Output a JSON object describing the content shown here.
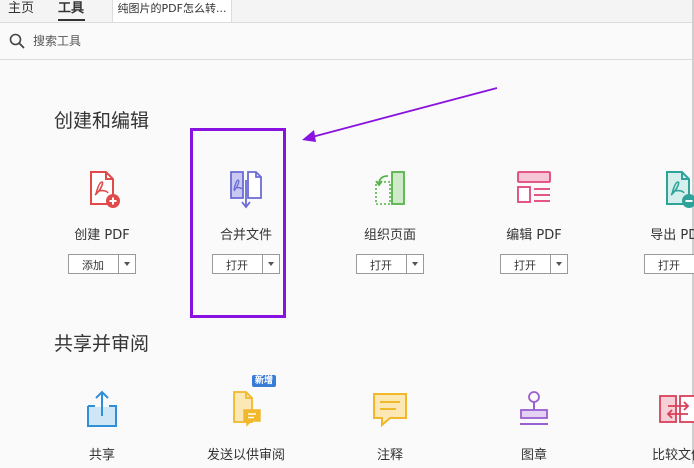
{
  "nav": {
    "home": "主页",
    "tools": "工具",
    "doc_tab": "纯图片的PDF怎么转..."
  },
  "search": {
    "placeholder": "搜索工具"
  },
  "sections": {
    "create_edit": "创建和编辑",
    "share_review": "共享并审阅"
  },
  "tools_create": [
    {
      "label": "创建 PDF",
      "button": "添加",
      "icon": "create-pdf-icon"
    },
    {
      "label": "合并文件",
      "button": "打开",
      "icon": "combine-files-icon"
    },
    {
      "label": "组织页面",
      "button": "打开",
      "icon": "organize-pages-icon"
    },
    {
      "label": "编辑 PDF",
      "button": "打开",
      "icon": "edit-pdf-icon"
    },
    {
      "label": "导出 PDF",
      "button": "打开",
      "icon": "export-pdf-icon"
    }
  ],
  "tools_share": [
    {
      "label": "共享",
      "icon": "share-icon"
    },
    {
      "label": "发送以供审阅",
      "icon": "send-review-icon",
      "badge": "新增"
    },
    {
      "label": "注释",
      "icon": "comment-icon"
    },
    {
      "label": "图章",
      "icon": "stamp-icon"
    },
    {
      "label": "比较文件",
      "icon": "compare-icon"
    }
  ],
  "colors": {
    "highlight": "#8a12e0",
    "create_red": "#e04a4a",
    "combine_purple": "#6b6bd6",
    "organize_green": "#57b34a",
    "edit_pink": "#e0457b",
    "export_teal": "#2fa39a",
    "share_blue": "#2f8fd8",
    "review_yellow": "#f0b82a",
    "stamp_purple": "#9a5fd0",
    "compare_red": "#d8405a"
  }
}
